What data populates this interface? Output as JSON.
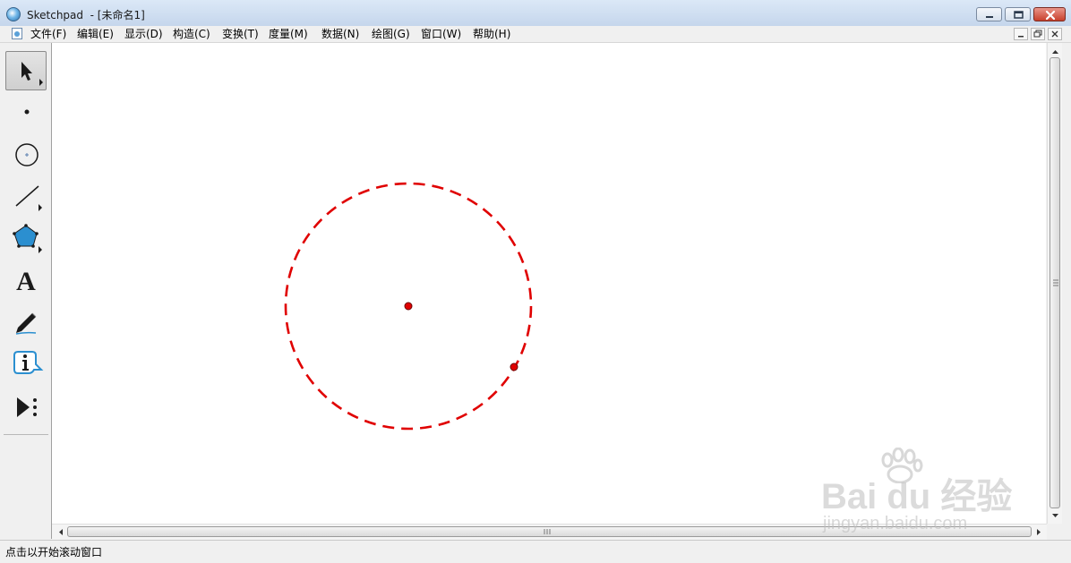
{
  "window": {
    "title": "Sketchpad  - [未命名1]"
  },
  "menubar": {
    "items": [
      {
        "label": "文件(F)"
      },
      {
        "label": "编辑(E)"
      },
      {
        "label": "显示(D)"
      },
      {
        "label": "构造(C)"
      },
      {
        "label": "变换(T)"
      },
      {
        "label": "度量(M)"
      },
      {
        "label": "数据(N)"
      },
      {
        "label": "绘图(G)"
      },
      {
        "label": "窗口(W)"
      },
      {
        "label": "帮助(H)"
      }
    ]
  },
  "toolbox": {
    "tools": [
      {
        "name": "selection-arrow-tool",
        "icon": "arrow-cursor-icon",
        "active": true
      },
      {
        "name": "point-tool",
        "icon": "point-icon",
        "active": false
      },
      {
        "name": "compass-tool",
        "icon": "circle-icon",
        "active": false
      },
      {
        "name": "straightedge-tool",
        "icon": "segment-icon",
        "active": false
      },
      {
        "name": "polygon-tool",
        "icon": "pentagon-icon",
        "active": false
      },
      {
        "name": "text-tool",
        "icon": "letter-a-icon",
        "active": false
      },
      {
        "name": "marker-tool",
        "icon": "pen-icon",
        "active": false
      },
      {
        "name": "information-tool",
        "icon": "info-icon",
        "active": false
      },
      {
        "name": "custom-tool",
        "icon": "play-menu-icon",
        "active": false
      }
    ]
  },
  "sketch": {
    "circle_style": "dashed",
    "circle_color": "#e00000",
    "point_color": "#e00000"
  },
  "statusbar": {
    "text": "点击以开始滚动窗口"
  },
  "watermark": {
    "brand": "Bai du 经验",
    "url": "jingyan.baidu.com"
  }
}
